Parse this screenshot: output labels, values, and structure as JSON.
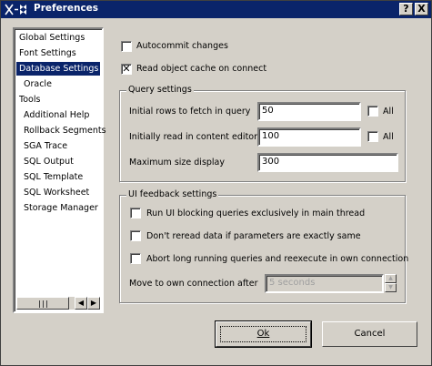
{
  "window": {
    "title": "Preferences",
    "help_glyph": "?",
    "close_glyph": "X"
  },
  "sidebar": {
    "items": [
      {
        "label": "Global Settings"
      },
      {
        "label": "Font Settings"
      },
      {
        "label": "Database Settings",
        "selected": true
      },
      {
        "label": "Oracle"
      },
      {
        "label": "Tools"
      },
      {
        "label": "Additional Help"
      },
      {
        "label": "Rollback Segments"
      },
      {
        "label": "SGA Trace"
      },
      {
        "label": "SQL Output"
      },
      {
        "label": "SQL Template"
      },
      {
        "label": "SQL Worksheet"
      },
      {
        "label": "Storage Manager"
      }
    ]
  },
  "options": {
    "autocommit": {
      "label": "Autocommit changes",
      "checked": false
    },
    "read_cache": {
      "label": "Read object cache on connect",
      "checked": true
    }
  },
  "query_settings": {
    "title": "Query settings",
    "initial_rows": {
      "label": "Initial rows to fetch in query",
      "value": "50",
      "all_label": "All"
    },
    "initially_read": {
      "label": "Initially read in content editor",
      "value": "100",
      "all_label": "All"
    },
    "max_size": {
      "label": "Maximum size display",
      "value": "300"
    }
  },
  "ui_feedback": {
    "title": "UI feedback settings",
    "run_blocking": {
      "label": "Run UI blocking queries exclusively in main thread"
    },
    "dont_reread": {
      "label": "Don't reread data if parameters are exactly same"
    },
    "abort_long": {
      "label": "Abort long running queries and reexecute in own connection"
    },
    "move_to_own": {
      "label": "Move to own connection after",
      "value": "5 seconds"
    }
  },
  "buttons": {
    "ok": "Ok",
    "cancel": "Cancel"
  },
  "colors": {
    "titlebar": "#0a246a",
    "selection": "#0a246a",
    "face": "#d4d0c8"
  }
}
